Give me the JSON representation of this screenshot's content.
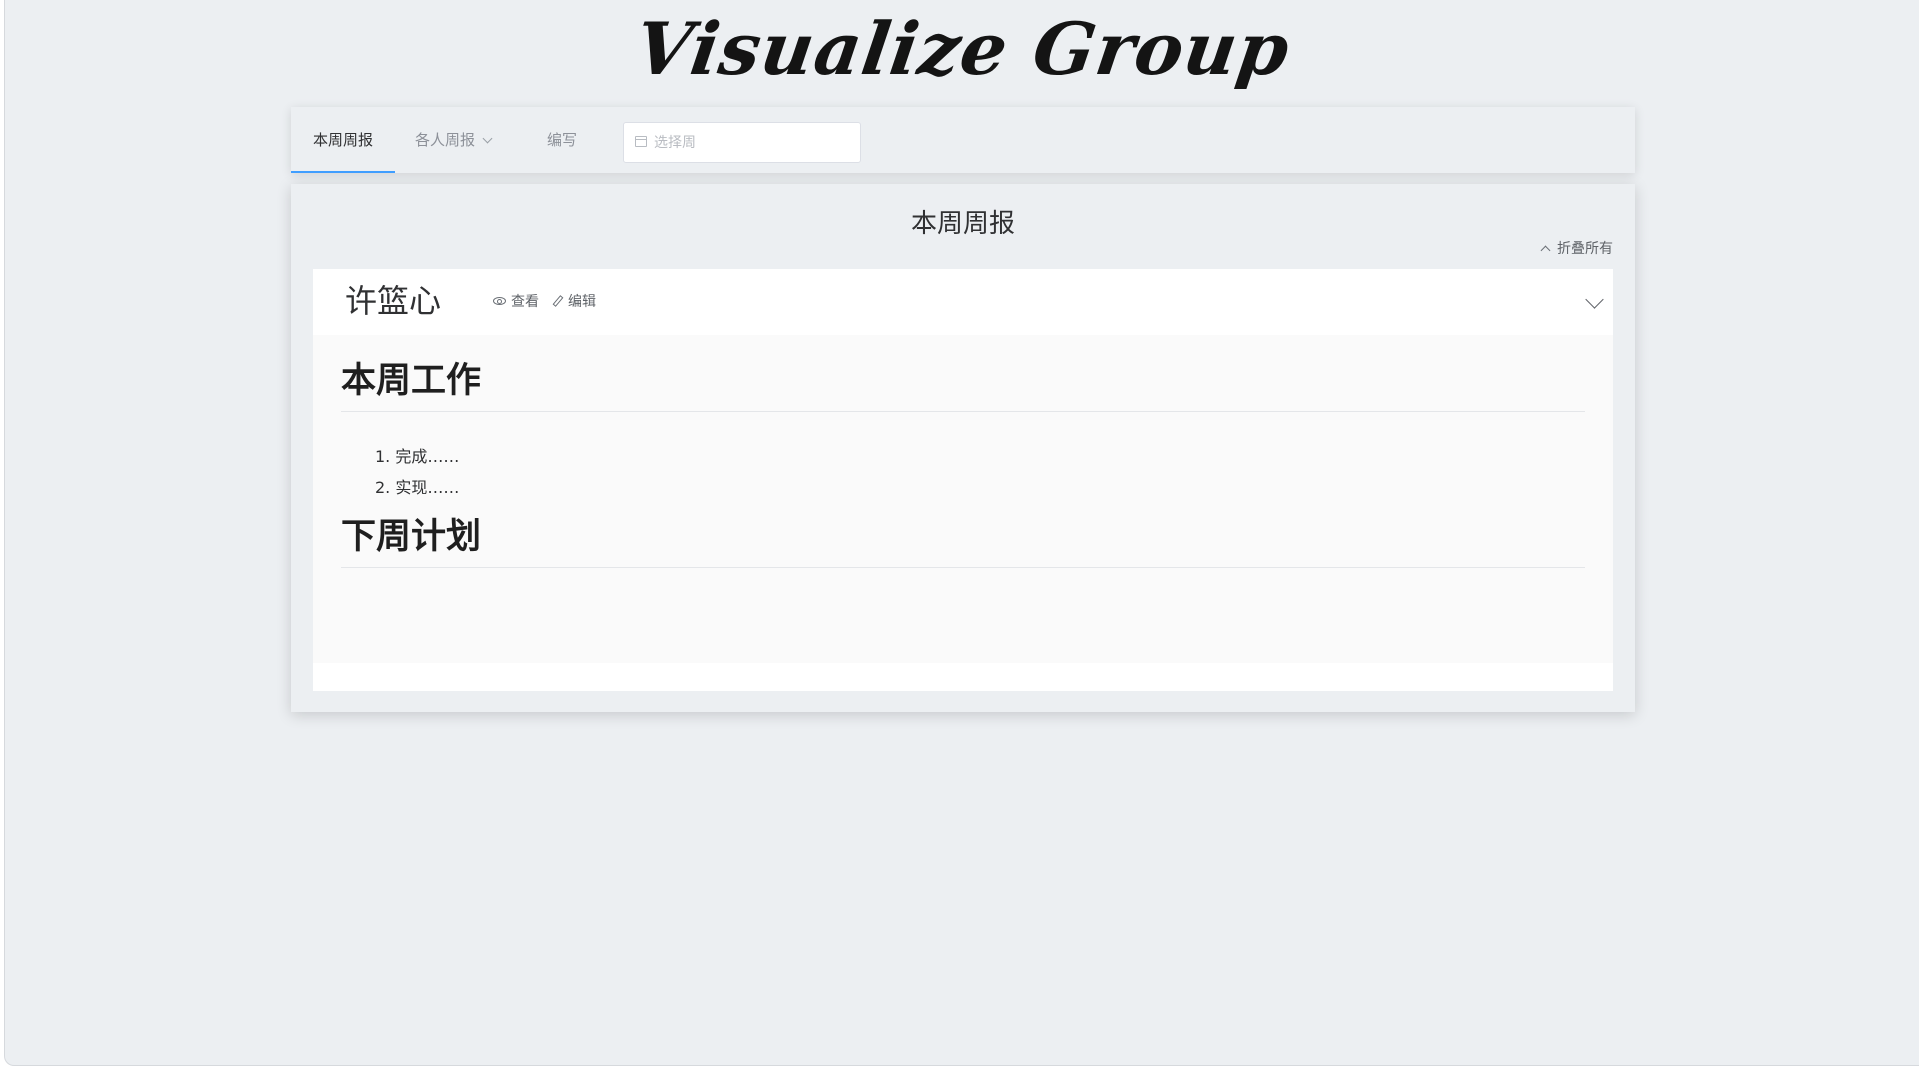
{
  "logo": {
    "text": "Visualize Group"
  },
  "nav": {
    "tabs": [
      {
        "label": "本周周报",
        "active": true
      },
      {
        "label": "各人周报",
        "has_dropdown": true
      },
      {
        "label": "编写"
      }
    ],
    "week_picker": {
      "placeholder": "选择周",
      "value": "",
      "icon": "calendar-icon"
    }
  },
  "page": {
    "title": "本周周报",
    "collapse_all_label": "折叠所有"
  },
  "reports": [
    {
      "name": "许篮心",
      "actions": {
        "view_label": "查看",
        "edit_label": "编辑"
      },
      "expanded": true,
      "sections": [
        {
          "heading": "本周工作",
          "items": [
            "完成……",
            "实现……"
          ]
        },
        {
          "heading": "下周计划",
          "items": []
        }
      ]
    }
  ],
  "colors": {
    "accent": "#409eff",
    "background": "#eceff2",
    "text": "#303133",
    "muted": "#8d9199"
  }
}
